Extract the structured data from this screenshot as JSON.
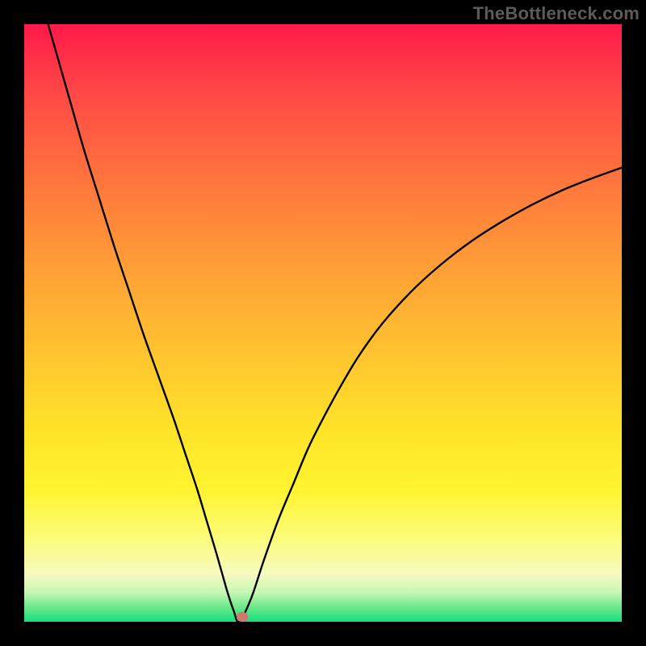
{
  "watermark": "TheBottleneck.com",
  "chart_data": {
    "type": "line",
    "title": "",
    "xlabel": "",
    "ylabel": "",
    "xlim": [
      0,
      100
    ],
    "ylim": [
      0,
      100
    ],
    "grid": false,
    "series": [
      {
        "name": "curve",
        "color": "#000000",
        "x": [
          4,
          6,
          8,
          10,
          12.5,
          15,
          17.5,
          20,
          22.5,
          25,
          27,
          29,
          30.5,
          32,
          33,
          34,
          35,
          36,
          38,
          40,
          42.5,
          45,
          47.5,
          50,
          53,
          56,
          60,
          65,
          70,
          75,
          80,
          85,
          90,
          95,
          100
        ],
        "y": [
          100,
          93,
          86,
          79,
          71,
          63,
          55.5,
          48,
          41,
          34,
          28,
          22,
          17,
          12,
          8.5,
          5,
          2,
          0,
          4,
          10,
          17,
          23,
          29,
          34,
          39.5,
          44.5,
          50,
          55.5,
          60,
          63.8,
          67,
          69.8,
          72.2,
          74.2,
          76
        ]
      }
    ],
    "marker": {
      "x": 36.5,
      "y": 0.8
    },
    "background_gradient": {
      "stops": [
        {
          "pos": 0.0,
          "color": "#ff1a4a"
        },
        {
          "pos": 0.12,
          "color": "#ff4a46"
        },
        {
          "pos": 0.28,
          "color": "#ff7a3c"
        },
        {
          "pos": 0.42,
          "color": "#ffa236"
        },
        {
          "pos": 0.56,
          "color": "#ffc62f"
        },
        {
          "pos": 0.68,
          "color": "#ffe328"
        },
        {
          "pos": 0.78,
          "color": "#fff430"
        },
        {
          "pos": 0.86,
          "color": "#fcfc7a"
        },
        {
          "pos": 0.92,
          "color": "#f6fac0"
        },
        {
          "pos": 0.95,
          "color": "#c8f7b6"
        },
        {
          "pos": 0.975,
          "color": "#6ee98c"
        },
        {
          "pos": 1.0,
          "color": "#13df7d"
        }
      ]
    }
  }
}
